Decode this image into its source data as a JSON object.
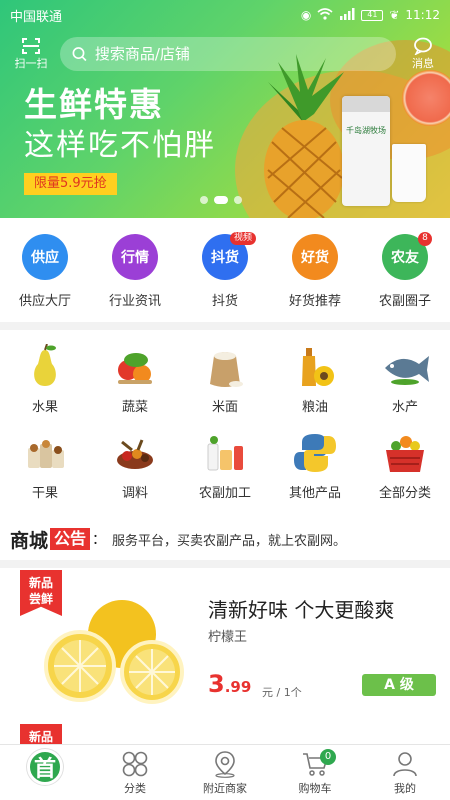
{
  "status": {
    "carrier": "中国联通",
    "battery": "41",
    "time": "11:12"
  },
  "topbar": {
    "scan_label": "扫一扫",
    "search_placeholder": "搜索商品/店铺",
    "message_label": "消息"
  },
  "banner": {
    "title": "生鲜特惠",
    "subtitle": "这样吃不怕胖",
    "promo": "限量5.9元抢",
    "milk_brand": "千岛湖牧场",
    "page_count": 3,
    "active_index": 1
  },
  "quick": [
    {
      "icon_text": "供应",
      "label": "供应大厅",
      "color": "#2f8ef0",
      "icon": "supply-icon"
    },
    {
      "icon_text": "行情",
      "label": "行业资讯",
      "color": "#9b3fd6",
      "icon": "market-trend-icon"
    },
    {
      "icon_text": "抖货",
      "label": "抖货",
      "color": "#2f6ff0",
      "badge": "视频",
      "icon": "video-goods-icon"
    },
    {
      "icon_text": "好货",
      "label": "好货推荐",
      "color": "#f28a1e",
      "icon": "good-goods-icon"
    },
    {
      "icon_text": "农友",
      "label": "农副圈子",
      "color": "#3db65a",
      "badge": "8",
      "icon": "farmer-circle-icon"
    }
  ],
  "categories": [
    {
      "label": "水果",
      "icon": "pear-icon"
    },
    {
      "label": "蔬菜",
      "icon": "vegetables-icon"
    },
    {
      "label": "米面",
      "icon": "rice-sack-icon"
    },
    {
      "label": "粮油",
      "icon": "oil-bottle-icon"
    },
    {
      "label": "水产",
      "icon": "fish-icon"
    },
    {
      "label": "干果",
      "icon": "nuts-icon"
    },
    {
      "label": "调料",
      "icon": "spices-icon"
    },
    {
      "label": "农副加工",
      "icon": "processed-goods-icon"
    },
    {
      "label": "其他产品",
      "icon": "other-products-icon"
    },
    {
      "label": "全部分类",
      "icon": "basket-icon"
    }
  ],
  "notice": {
    "brand": "商城",
    "tag": "公告",
    "colon": "：",
    "text": "服务平台，买卖农副产品，就上农副网。"
  },
  "products": [
    {
      "ribbon_line1": "新品",
      "ribbon_line2": "尝鲜",
      "title": "清新好味 个大更酸爽",
      "subtitle": "柠檬王",
      "price_int": "3",
      "price_dec": ".99",
      "unit": "元 / 1个",
      "grade": "A 级"
    },
    {
      "ribbon_line1": "新品"
    }
  ],
  "tabs": [
    {
      "label": "首",
      "icon": "home-icon"
    },
    {
      "label": "分类",
      "icon": "category-icon"
    },
    {
      "label": "附近商家",
      "icon": "location-pin-icon"
    },
    {
      "label": "购物车",
      "icon": "cart-icon",
      "badge": "0"
    },
    {
      "label": "我的",
      "icon": "user-icon"
    }
  ]
}
